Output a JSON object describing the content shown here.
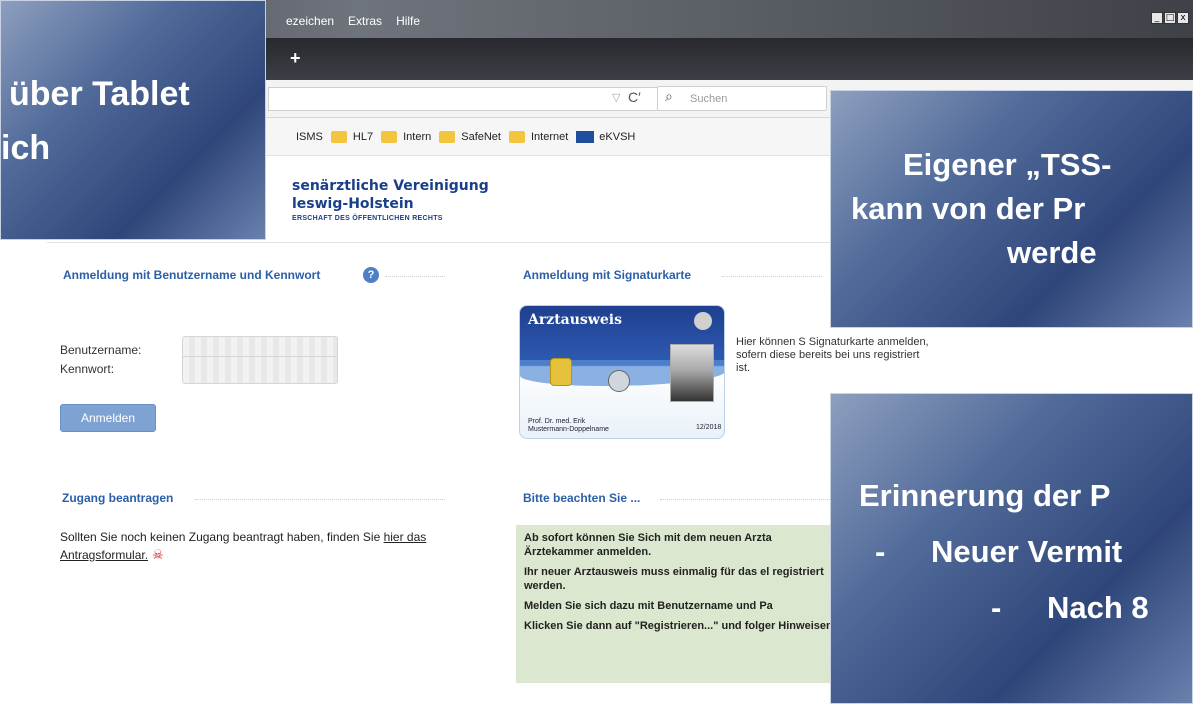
{
  "browser": {
    "menu": [
      "ezeichen",
      "Extras",
      "Hilfe"
    ],
    "window_controls": [
      "_",
      "□",
      "x"
    ],
    "new_tab": "+",
    "search_placeholder": "Suchen",
    "bookmarks": [
      "ISMS",
      "HL7",
      "Intern",
      "SafeNet",
      "Internet",
      "eKVSH"
    ]
  },
  "header": {
    "org_line1": "senärztliche Vereinigung",
    "org_line2": "leswig-Holstein",
    "org_line3": "ERSCHAFT DES ÖFFENTLICHEN RECHTS"
  },
  "login": {
    "heading": "Anmeldung mit Benutzername und Kennwort",
    "help": "?",
    "username_label": "Benutzername:",
    "password_label": "Kennwort:",
    "submit": "Anmelden"
  },
  "signature": {
    "heading": "Anmeldung mit Signaturkarte",
    "card_title": "Arztausweis",
    "card_name": "Prof. Dr. med. Erik",
    "card_name2": "Mustermann-Doppelname",
    "card_date": "12/2018",
    "description": "Hier können S Signaturkarte anmelden, sofern diese bereits bei uns registriert ist."
  },
  "request": {
    "heading": "Zugang beantragen",
    "text_before": "Sollten Sie noch keinen Zugang beantragt haben, finden Sie ",
    "link": "hier das Antragsformular.",
    "pdf_icon": "pdf-icon"
  },
  "notice": {
    "heading": "Bitte beachten Sie ...",
    "p1": "Ab sofort können Sie Sich mit dem neuen Arzta Ärztekammer anmelden.",
    "p2": "Ihr neuer Arztausweis muss einmalig für das el registriert werden.",
    "p3": "Melden Sie sich dazu mit Benutzername und Pa",
    "p4": "Klicken Sie dann auf \"Registrieren...\" und folger Hinweisen."
  },
  "overlays": {
    "top_left_1": "über Tablet",
    "top_left_2": "ich",
    "right_1_l1": "Eigener „TSS-",
    "right_1_l2": "kann von der Pr",
    "right_1_l3": "werde",
    "right_2_l1": "Erinnerung der P",
    "right_2_l2": "Neuer Vermit",
    "right_2_l3": "Nach 8",
    "dash": "-"
  }
}
